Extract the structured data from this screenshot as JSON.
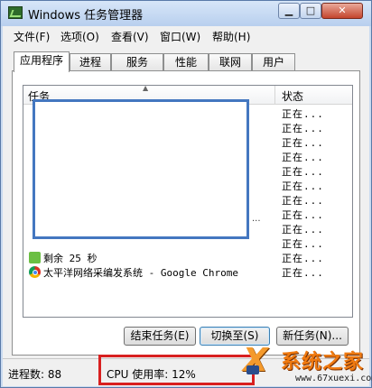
{
  "window": {
    "title": "Windows 任务管理器"
  },
  "menu": [
    "文件(F)",
    "选项(O)",
    "查看(V)",
    "窗口(W)",
    "帮助(H)"
  ],
  "tabs": [
    "应用程序",
    "进程",
    "服务",
    "性能",
    "联网",
    "用户"
  ],
  "active_tab": "应用程序",
  "table": {
    "headers": {
      "task": "任务",
      "status": "状态"
    },
    "rows": [
      {
        "task": "",
        "status": "正在..."
      },
      {
        "task": "",
        "status": "正在..."
      },
      {
        "task": "",
        "status": "正在..."
      },
      {
        "task": "",
        "status": "正在..."
      },
      {
        "task": "",
        "status": "正在..."
      },
      {
        "task": "",
        "status": "正在..."
      },
      {
        "task": "",
        "status": "正在..."
      },
      {
        "task": "",
        "status": "正在..."
      },
      {
        "task": "",
        "status": "正在..."
      },
      {
        "task": "",
        "status": "正在..."
      },
      {
        "task": "剩余 25 秒",
        "status": "正在..."
      },
      {
        "task": "太平洋网络采编发系统 - Google Chrome",
        "status": "正在..."
      }
    ],
    "row_icons": [
      "",
      "",
      "",
      "",
      "",
      "",
      "",
      "",
      "",
      "",
      "arrow-icon",
      "chrome-icon"
    ],
    "truncated_marker": "..."
  },
  "buttons": {
    "end_task": "结束任务(E)",
    "switch_to": "切换至(S)",
    "new_task": "新任务(N)..."
  },
  "status": {
    "processes": "进程数: 88",
    "cpu": "CPU 使用率: 12%"
  },
  "watermark": {
    "mark": "X",
    "brand": "系统之家",
    "url": "www.67xuexi.com"
  },
  "colors": {
    "title_bg": "#c9daf0",
    "close_button": "#c4452d",
    "highlight_box": "#d82020",
    "redaction_box": "#4477c0",
    "watermark": "#f07a10"
  }
}
